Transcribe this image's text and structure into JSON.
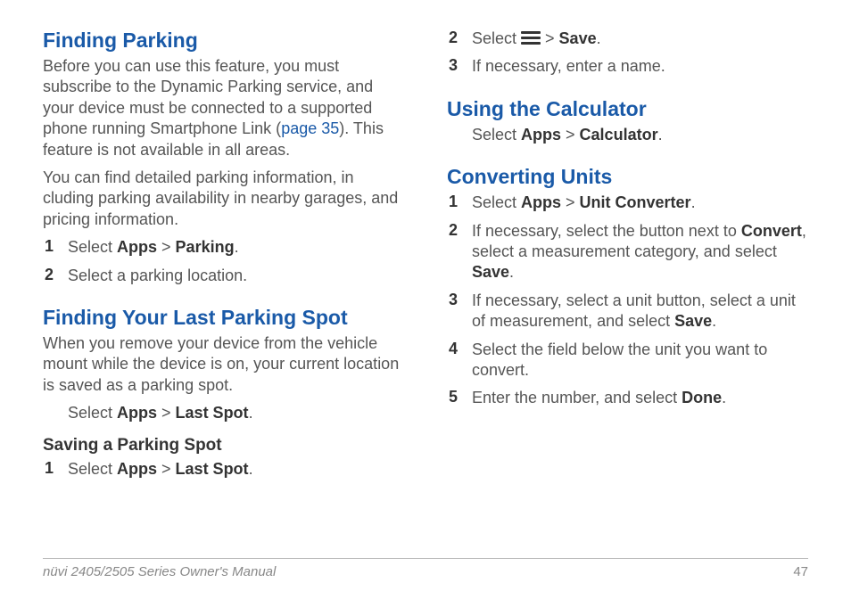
{
  "left": {
    "h2a": "Finding Parking",
    "p1_a": "Before you can use this feature, you must subscribe to the Dynamic Parking service, and your device must be connected to a supported phone running Smartphone Link (",
    "p1_link": "page 35",
    "p1_b": "). This feature is not available in all areas.",
    "p2": "You can find detailed parking information, in cluding parking availability in nearby garages, and pricing information.",
    "step1_num": "1",
    "step1_a": "Select ",
    "step1_b1": "Apps",
    "step1_gt": " > ",
    "step1_b2": "Parking",
    "step1_c": ".",
    "step2_num": "2",
    "step2": "Select a parking location.",
    "h2b": "Finding Your Last Parking Spot",
    "p3": "When you remove your device from the vehicle mount while the device is on, your current location is saved as a parking spot.",
    "p4_a": "Select ",
    "p4_b1": "Apps",
    "p4_gt": " > ",
    "p4_b2": "Last Spot",
    "p4_c": ".",
    "h3": "Saving a Parking Spot",
    "sp1_num": "1",
    "sp1_a": "Select ",
    "sp1_b1": "Apps",
    "sp1_gt": " > ",
    "sp1_b2": "Last Spot",
    "sp1_c": "."
  },
  "right": {
    "sp2_num": "2",
    "sp2_a": "Select ",
    "sp2_gt": " > ",
    "sp2_b": "Save",
    "sp2_c": ".",
    "sp3_num": "3",
    "sp3": "If necessary, enter a name.",
    "h2c": "Using the Calculator",
    "calc_a": "Select ",
    "calc_b1": "Apps",
    "calc_gt": " > ",
    "calc_b2": "Calculator",
    "calc_c": ".",
    "h2d": "Converting Units",
    "cu1_num": "1",
    "cu1_a": "Select ",
    "cu1_b1": "Apps",
    "cu1_gt": " > ",
    "cu1_b2": "Unit Converter",
    "cu1_c": ".",
    "cu2_num": "2",
    "cu2_a": "If necessary, select the button next to ",
    "cu2_b1": "Convert",
    "cu2_b": ", select a measurement category, and select ",
    "cu2_b2": "Save",
    "cu2_c": ".",
    "cu3_num": "3",
    "cu3_a": "If necessary, select a unit button, select a unit of measurement, and select ",
    "cu3_b": "Save",
    "cu3_c": ".",
    "cu4_num": "4",
    "cu4": "Select the field below the unit you want to convert.",
    "cu5_num": "5",
    "cu5_a": "Enter the number, and select ",
    "cu5_b": "Done",
    "cu5_c": "."
  },
  "footer": {
    "title": "nüvi 2405/2505 Series Owner's Manual",
    "page": "47"
  }
}
